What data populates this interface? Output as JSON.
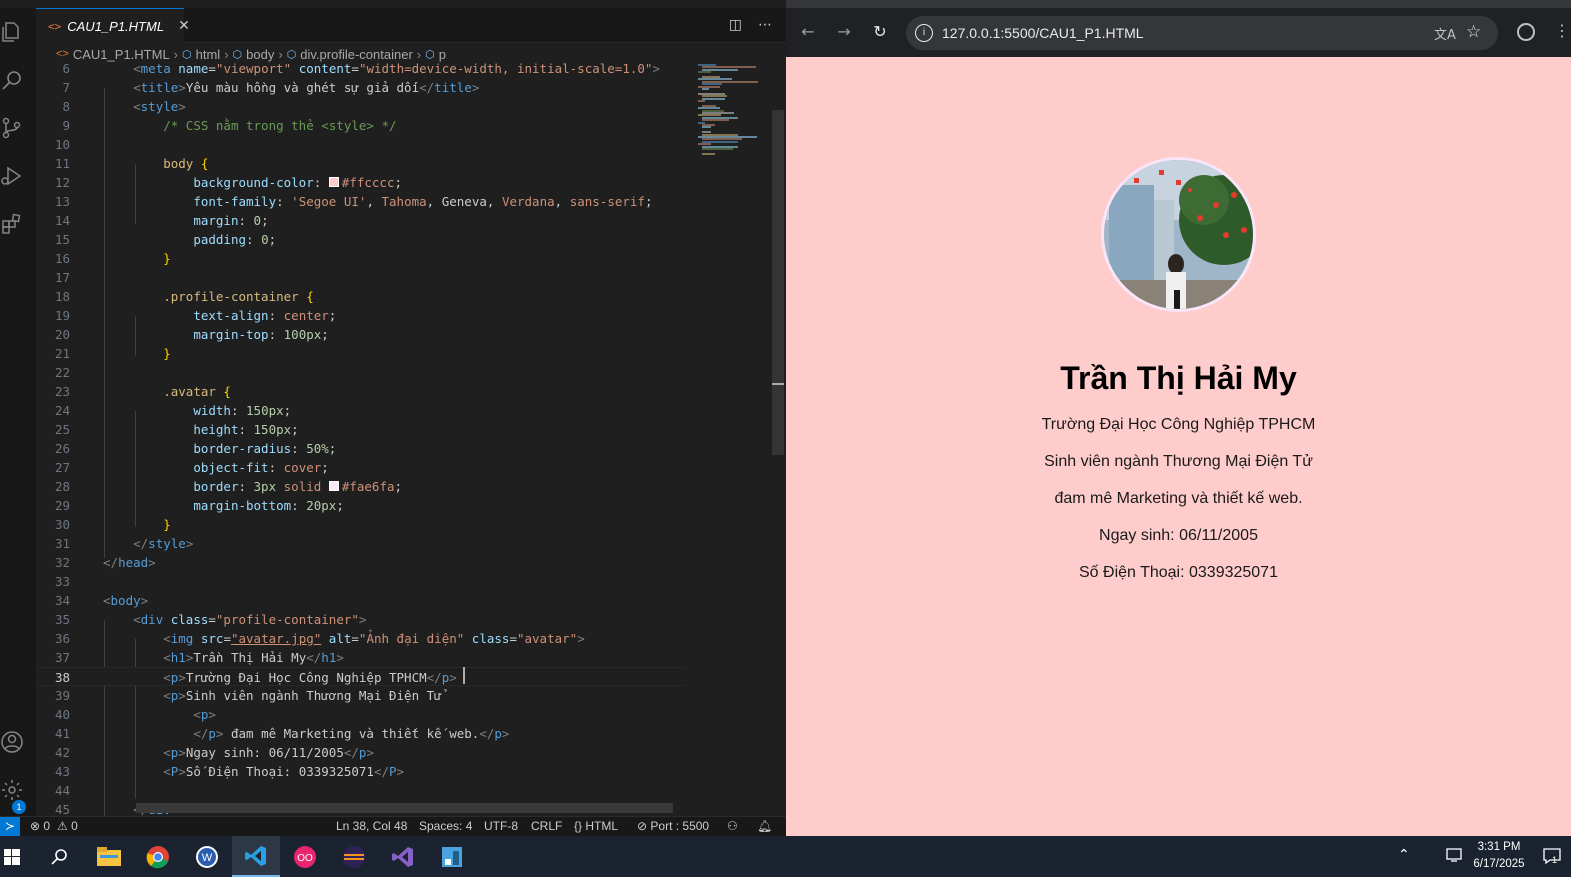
{
  "vscode": {
    "tab": {
      "icon": "<>",
      "filename": "CAU1_P1.HTML",
      "close": "✕"
    },
    "breadcrumb": [
      "CAU1_P1.HTML",
      "html",
      "body",
      "div.profile-container",
      "p"
    ],
    "lines": [
      {
        "n": "6",
        "tokens": [
          [
            "    ",
            "w"
          ],
          [
            "<",
            "g"
          ],
          [
            "meta",
            "t"
          ],
          [
            " name",
            "a"
          ],
          [
            "=",
            "w"
          ],
          [
            "\"viewport\"",
            "s"
          ],
          [
            " content",
            "a"
          ],
          [
            "=",
            "w"
          ],
          [
            "\"width=device-width, initial-scale=1.0\"",
            "s"
          ],
          [
            ">",
            "g"
          ]
        ]
      },
      {
        "n": "7",
        "tokens": [
          [
            "    ",
            "w"
          ],
          [
            "<",
            "g"
          ],
          [
            "title",
            "t"
          ],
          [
            ">",
            "g"
          ],
          [
            "Yêu màu hồng và ghét sự giả dối",
            "w"
          ],
          [
            "</",
            "g"
          ],
          [
            "title",
            "t"
          ],
          [
            ">",
            "g"
          ]
        ]
      },
      {
        "n": "8",
        "tokens": [
          [
            "    ",
            "w"
          ],
          [
            "<",
            "g"
          ],
          [
            "style",
            "t"
          ],
          [
            ">",
            "g"
          ]
        ]
      },
      {
        "n": "9",
        "tokens": [
          [
            "        ",
            "w"
          ],
          [
            "/* CSS nằm trong thẻ <style> */",
            "c"
          ]
        ]
      },
      {
        "n": "10",
        "tokens": []
      },
      {
        "n": "11",
        "tokens": [
          [
            "        ",
            "w"
          ],
          [
            "body",
            "sel"
          ],
          [
            " {",
            "b"
          ]
        ]
      },
      {
        "n": "12",
        "tokens": [
          [
            "            ",
            "w"
          ],
          [
            "background-color",
            "p"
          ],
          [
            ": ",
            "w"
          ],
          [
            "■",
            "swatch-ffcccc"
          ],
          [
            "#ffcccc",
            "v"
          ],
          [
            ";",
            "w"
          ]
        ]
      },
      {
        "n": "13",
        "tokens": [
          [
            "            ",
            "w"
          ],
          [
            "font-family",
            "p"
          ],
          [
            ": ",
            "w"
          ],
          [
            "'Segoe UI'",
            "v"
          ],
          [
            ", ",
            "w"
          ],
          [
            "Tahoma",
            "v"
          ],
          [
            ", ",
            "w"
          ],
          [
            "Geneva",
            "w"
          ],
          [
            ", ",
            "w"
          ],
          [
            "Verdana",
            "v"
          ],
          [
            ", ",
            "w"
          ],
          [
            "sans-serif",
            "v"
          ],
          [
            ";",
            "w"
          ]
        ]
      },
      {
        "n": "14",
        "tokens": [
          [
            "            ",
            "w"
          ],
          [
            "margin",
            "p"
          ],
          [
            ": ",
            "w"
          ],
          [
            "0",
            "num"
          ],
          [
            ";",
            "w"
          ]
        ]
      },
      {
        "n": "15",
        "tokens": [
          [
            "            ",
            "w"
          ],
          [
            "padding",
            "p"
          ],
          [
            ": ",
            "w"
          ],
          [
            "0",
            "num"
          ],
          [
            ";",
            "w"
          ]
        ]
      },
      {
        "n": "16",
        "tokens": [
          [
            "        ",
            "w"
          ],
          [
            "}",
            "b"
          ]
        ]
      },
      {
        "n": "17",
        "tokens": []
      },
      {
        "n": "18",
        "tokens": [
          [
            "        ",
            "w"
          ],
          [
            ".profile-container",
            "sel"
          ],
          [
            " {",
            "b"
          ]
        ]
      },
      {
        "n": "19",
        "tokens": [
          [
            "            ",
            "w"
          ],
          [
            "text-align",
            "p"
          ],
          [
            ": ",
            "w"
          ],
          [
            "center",
            "v"
          ],
          [
            ";",
            "w"
          ]
        ]
      },
      {
        "n": "20",
        "tokens": [
          [
            "            ",
            "w"
          ],
          [
            "margin-top",
            "p"
          ],
          [
            ": ",
            "w"
          ],
          [
            "100px",
            "num"
          ],
          [
            ";",
            "w"
          ]
        ]
      },
      {
        "n": "21",
        "tokens": [
          [
            "        ",
            "w"
          ],
          [
            "}",
            "b"
          ]
        ]
      },
      {
        "n": "22",
        "tokens": []
      },
      {
        "n": "23",
        "tokens": [
          [
            "        ",
            "w"
          ],
          [
            ".avatar",
            "sel"
          ],
          [
            " {",
            "b"
          ]
        ]
      },
      {
        "n": "24",
        "tokens": [
          [
            "            ",
            "w"
          ],
          [
            "width",
            "p"
          ],
          [
            ": ",
            "w"
          ],
          [
            "150px",
            "num"
          ],
          [
            ";",
            "w"
          ]
        ]
      },
      {
        "n": "25",
        "tokens": [
          [
            "            ",
            "w"
          ],
          [
            "height",
            "p"
          ],
          [
            ": ",
            "w"
          ],
          [
            "150px",
            "num"
          ],
          [
            ";",
            "w"
          ]
        ]
      },
      {
        "n": "26",
        "tokens": [
          [
            "            ",
            "w"
          ],
          [
            "border-radius",
            "p"
          ],
          [
            ": ",
            "w"
          ],
          [
            "50%",
            "num"
          ],
          [
            ";",
            "w"
          ]
        ]
      },
      {
        "n": "27",
        "tokens": [
          [
            "            ",
            "w"
          ],
          [
            "object-fit",
            "p"
          ],
          [
            ": ",
            "w"
          ],
          [
            "cover",
            "v"
          ],
          [
            ";",
            "w"
          ]
        ]
      },
      {
        "n": "28",
        "tokens": [
          [
            "            ",
            "w"
          ],
          [
            "border",
            "p"
          ],
          [
            ": ",
            "w"
          ],
          [
            "3px",
            "num"
          ],
          [
            " ",
            "w"
          ],
          [
            "solid",
            "v"
          ],
          [
            " ",
            "w"
          ],
          [
            "■",
            "swatch-fae6fa"
          ],
          [
            "#fae6fa",
            "v"
          ],
          [
            ";",
            "w"
          ]
        ]
      },
      {
        "n": "29",
        "tokens": [
          [
            "            ",
            "w"
          ],
          [
            "margin-bottom",
            "p"
          ],
          [
            ": ",
            "w"
          ],
          [
            "20px",
            "num"
          ],
          [
            ";",
            "w"
          ]
        ]
      },
      {
        "n": "30",
        "tokens": [
          [
            "        ",
            "w"
          ],
          [
            "}",
            "b"
          ]
        ]
      },
      {
        "n": "31",
        "tokens": [
          [
            "    ",
            "w"
          ],
          [
            "</",
            "g"
          ],
          [
            "style",
            "t"
          ],
          [
            ">",
            "g"
          ]
        ]
      },
      {
        "n": "32",
        "tokens": [
          [
            "",
            "w"
          ],
          [
            "</",
            "g"
          ],
          [
            "head",
            "t"
          ],
          [
            ">",
            "g"
          ]
        ]
      },
      {
        "n": "33",
        "tokens": []
      },
      {
        "n": "34",
        "tokens": [
          [
            "",
            "w"
          ],
          [
            "<",
            "g"
          ],
          [
            "body",
            "t"
          ],
          [
            ">",
            "g"
          ]
        ]
      },
      {
        "n": "35",
        "tokens": [
          [
            "    ",
            "w"
          ],
          [
            "<",
            "g"
          ],
          [
            "div",
            "t"
          ],
          [
            " class",
            "a"
          ],
          [
            "=",
            "w"
          ],
          [
            "\"profile-container\"",
            "s"
          ],
          [
            ">",
            "g"
          ]
        ]
      },
      {
        "n": "36",
        "tokens": [
          [
            "        ",
            "w"
          ],
          [
            "<",
            "g"
          ],
          [
            "img",
            "t"
          ],
          [
            " src",
            "a"
          ],
          [
            "=",
            "w"
          ],
          [
            "\"avatar.jpg\"",
            "su"
          ],
          [
            " alt",
            "a"
          ],
          [
            "=",
            "w"
          ],
          [
            "\"Ảnh đại diện\"",
            "s"
          ],
          [
            " class",
            "a"
          ],
          [
            "=",
            "w"
          ],
          [
            "\"avatar\"",
            "s"
          ],
          [
            ">",
            "g"
          ]
        ]
      },
      {
        "n": "37",
        "tokens": [
          [
            "        ",
            "w"
          ],
          [
            "<",
            "g"
          ],
          [
            "h1",
            "t"
          ],
          [
            ">",
            "g"
          ],
          [
            "Trần Thị Hải My",
            "w"
          ],
          [
            "</",
            "g"
          ],
          [
            "h1",
            "t"
          ],
          [
            ">",
            "g"
          ]
        ]
      },
      {
        "n": "38",
        "tokens": [
          [
            "        ",
            "w"
          ],
          [
            "<",
            "g"
          ],
          [
            "p",
            "t"
          ],
          [
            ">",
            "g"
          ],
          [
            "Trường Đại Học Công Nghiệp TPHCM",
            "w"
          ],
          [
            "</",
            "g"
          ],
          [
            "p",
            "t"
          ],
          [
            ">",
            "g"
          ]
        ],
        "current": true
      },
      {
        "n": "39",
        "tokens": [
          [
            "        ",
            "w"
          ],
          [
            "<",
            "g"
          ],
          [
            "p",
            "t"
          ],
          [
            ">",
            "g"
          ],
          [
            "Sinh viên ngành Thương Mại Điện Tử",
            "w"
          ]
        ]
      },
      {
        "n": "40",
        "tokens": [
          [
            "            ",
            "w"
          ],
          [
            "<",
            "g"
          ],
          [
            "p",
            "t"
          ],
          [
            ">",
            "g"
          ]
        ]
      },
      {
        "n": "41",
        "tokens": [
          [
            "            ",
            "w"
          ],
          [
            "</",
            "g"
          ],
          [
            "p",
            "t"
          ],
          [
            ">",
            "g"
          ],
          [
            " đam mê Marketing và thiết kế web.",
            "w"
          ],
          [
            "</",
            "g"
          ],
          [
            "p",
            "t"
          ],
          [
            ">",
            "g"
          ]
        ]
      },
      {
        "n": "42",
        "tokens": [
          [
            "        ",
            "w"
          ],
          [
            "<",
            "g"
          ],
          [
            "p",
            "t"
          ],
          [
            ">",
            "g"
          ],
          [
            "Ngay sinh: 06/11/2005",
            "w"
          ],
          [
            "</",
            "g"
          ],
          [
            "p",
            "t"
          ],
          [
            ">",
            "g"
          ]
        ]
      },
      {
        "n": "43",
        "tokens": [
          [
            "        ",
            "w"
          ],
          [
            "<",
            "g"
          ],
          [
            "P",
            "t"
          ],
          [
            ">",
            "g"
          ],
          [
            "Số Điện Thoại: 0339325071",
            "w"
          ],
          [
            "</",
            "g"
          ],
          [
            "P",
            "t"
          ],
          [
            ">",
            "g"
          ]
        ]
      },
      {
        "n": "44",
        "tokens": []
      },
      {
        "n": "45",
        "tokens": [
          [
            "    ",
            "w"
          ],
          [
            "</",
            "g"
          ],
          [
            "div",
            "t"
          ],
          [
            ">",
            "g"
          ]
        ]
      }
    ],
    "status": {
      "errors": "⊗ 0",
      "warnings": "⚠ 0",
      "position": "Ln 38, Col 48",
      "spaces": "Spaces: 4",
      "encoding": "UTF-8",
      "eol": "CRLF",
      "language": "{} HTML",
      "port": "⊘ Port : 5500"
    },
    "activity_badge": "1"
  },
  "browser": {
    "url": "127.0.0.1:5500/CAU1_P1.HTML",
    "profile": {
      "name": "Trần Thị Hải My",
      "lines": [
        "Trường Đại Học Công Nghiệp TPHCM",
        "Sinh viên ngành Thương Mại Điện Tử",
        "đam mê Marketing và thiết kế web.",
        "Ngay sinh: 06/11/2005",
        "Số Điện Thoại: 0339325071"
      ]
    }
  },
  "taskbar": {
    "time": "3:31 PM",
    "date": "6/17/2025",
    "notif_count": "1"
  },
  "colors": {
    "tag": "#569cd6",
    "angle": "#808080",
    "attr": "#9cdcfe",
    "string": "#ce9178",
    "comment": "#6a9955",
    "selector": "#d7ba7d",
    "brace": "#ffd700",
    "prop": "#9cdcfe",
    "value": "#ce9178",
    "number": "#b5cea8",
    "text": "#cccccc",
    "bg_page": "#ffcccc"
  }
}
